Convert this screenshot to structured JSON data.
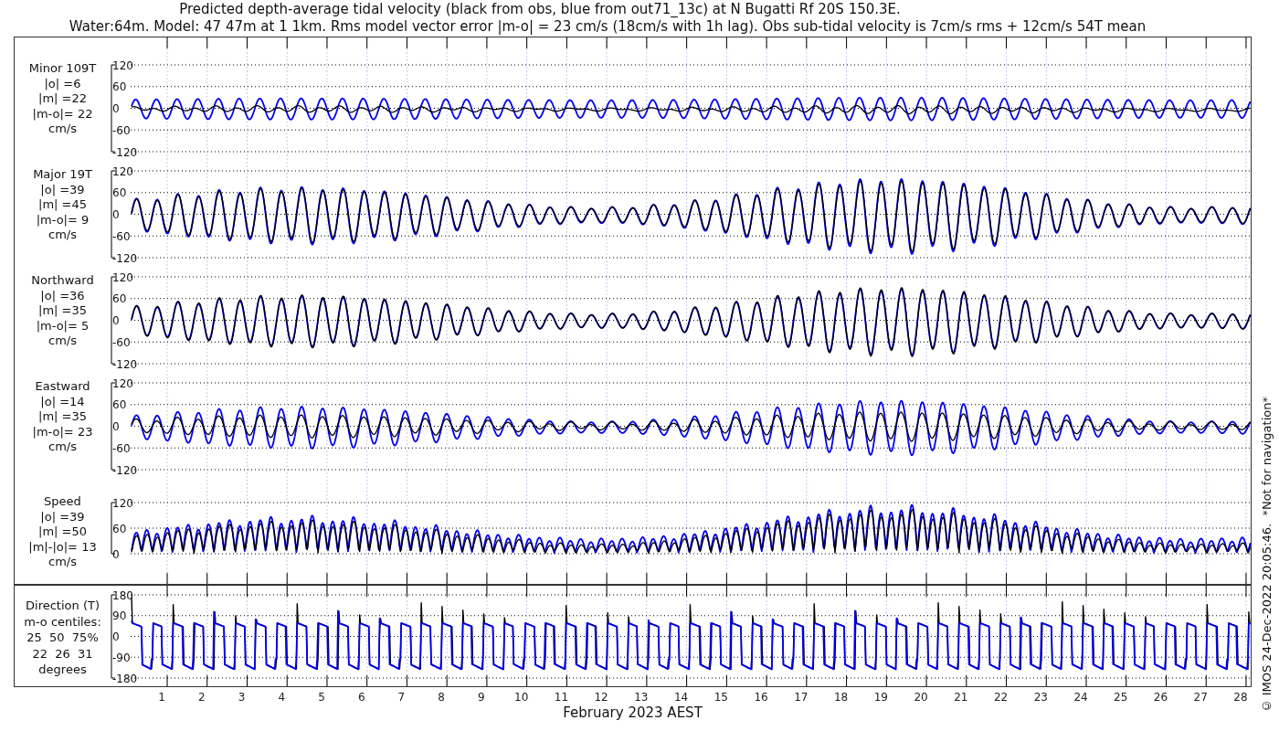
{
  "title": {
    "line_1": "Predicted depth-average tidal velocity (black from obs, blue from out71_13c) at N Bugatti Rf 20S 150.3E.",
    "line_2": "Water:64m. Model: 47 47m at 1 1km. Rms model vector error |m-o| = 23 cm/s (18cm/s with 1h lag). Obs sub-tidal velocity is 7cm/s rms + 12cm/s 54T mean"
  },
  "panels": [
    {
      "kind": "component",
      "label_lines": [
        "Minor 109T",
        "|o| =6",
        "|m| =22",
        "|m-o|= 22",
        "cm/s"
      ],
      "yticks": [
        "120",
        "60",
        "0",
        "-60",
        "-120"
      ]
    },
    {
      "kind": "component",
      "label_lines": [
        "Major 19T",
        "|o| =39",
        "|m| =45",
        "|m-o|= 9",
        "cm/s"
      ],
      "yticks": [
        "120",
        "60",
        "0",
        "-60",
        "-120"
      ]
    },
    {
      "kind": "component",
      "label_lines": [
        "Northward",
        "|o| =36",
        "|m| =35",
        "|m-o|= 5",
        "cm/s"
      ],
      "yticks": [
        "120",
        "60",
        "0",
        "-60",
        "-120"
      ]
    },
    {
      "kind": "component",
      "label_lines": [
        "Eastward",
        "|o| =14",
        "|m| =35",
        "|m-o|= 23",
        "cm/s"
      ],
      "yticks": [
        "120",
        "60",
        "0",
        "-60",
        "-120"
      ]
    },
    {
      "kind": "speed",
      "label_lines": [
        "Speed",
        "|o| =39",
        "|m| =50",
        "|m|-|o|= 13",
        "cm/s"
      ],
      "yticks": [
        "120",
        "60",
        "0"
      ]
    }
  ],
  "direction_panel": {
    "label_lines": [
      "Direction (T)",
      "m-o centiles:",
      "25  50  75%",
      "22  26  31",
      "degrees"
    ],
    "yticks": [
      "180",
      "90",
      "0",
      "-90",
      "-180"
    ]
  },
  "x_axis": {
    "ticks": [
      "1",
      "2",
      "3",
      "4",
      "5",
      "6",
      "7",
      "8",
      "9",
      "10",
      "11",
      "12",
      "13",
      "14",
      "15",
      "16",
      "17",
      "18",
      "19",
      "20",
      "21",
      "22",
      "23",
      "24",
      "25",
      "26",
      "27",
      "28"
    ],
    "label": "February 2023 AEST"
  },
  "footnote": "© IMOS 24-Dec-2022 20:05:46.  *Not for navigation*"
}
